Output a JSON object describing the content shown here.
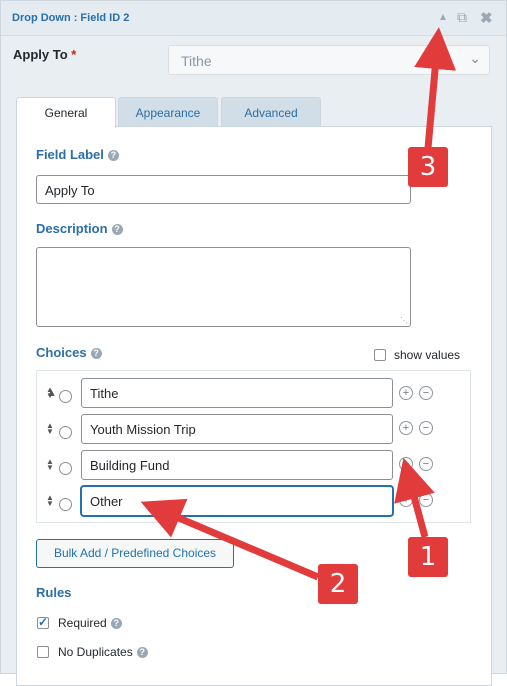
{
  "header": {
    "title": "Drop Down : Field ID 2"
  },
  "apply_to": {
    "label": "Apply To",
    "required_mark": "*",
    "selected": "Tithe"
  },
  "tabs": [
    {
      "label": "General"
    },
    {
      "label": "Appearance"
    },
    {
      "label": "Advanced"
    }
  ],
  "field_label": {
    "label": "Field Label",
    "value": "Apply To"
  },
  "description": {
    "label": "Description",
    "value": ""
  },
  "choices": {
    "label": "Choices",
    "show_values_label": "show values",
    "items": [
      {
        "value": "Tithe"
      },
      {
        "value": "Youth Mission Trip"
      },
      {
        "value": "Building Fund"
      },
      {
        "value": "Other"
      }
    ],
    "bulk_button": "Bulk Add / Predefined Choices"
  },
  "rules": {
    "label": "Rules",
    "required_label": "Required",
    "required_checked": true,
    "no_duplicates_label": "No Duplicates",
    "no_duplicates_checked": false
  },
  "annotations": {
    "badge_1": "1",
    "badge_2": "2",
    "badge_3": "3",
    "color": "#e23b3b"
  }
}
